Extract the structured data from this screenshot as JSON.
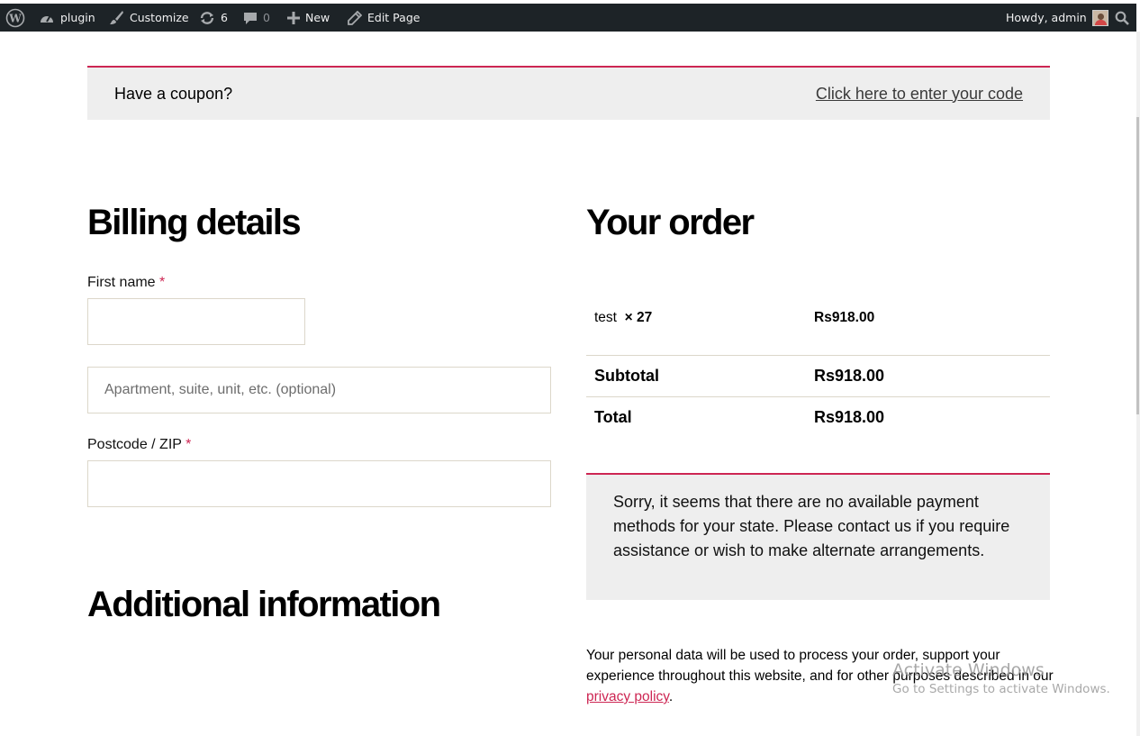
{
  "admin_bar": {
    "site_name": "plugin",
    "customize": "Customize",
    "updates_count": "6",
    "comments_count": "0",
    "new_label": "New",
    "edit_page": "Edit Page",
    "greeting": "Howdy, admin",
    "icons": [
      "wordpress-logo-icon",
      "dashboard-icon",
      "brush-icon",
      "updates-icon",
      "comment-icon",
      "plus-icon",
      "pencil-icon",
      "avatar",
      "search-icon"
    ]
  },
  "coupon": {
    "prompt": "Have a coupon?",
    "link": "Click here to enter your code"
  },
  "billing": {
    "heading": "Billing details",
    "first_name_label": "First name",
    "required_mark": "*",
    "first_name_value": "",
    "address2_placeholder": "Apartment, suite, unit, etc. (optional)",
    "postcode_label": "Postcode / ZIP",
    "postcode_value": ""
  },
  "additional": {
    "heading": "Additional information"
  },
  "order": {
    "heading": "Your order",
    "items": [
      {
        "name": "test",
        "qty": "× 27",
        "total": "Rs918.00"
      }
    ],
    "subtotal_label": "Subtotal",
    "subtotal_value": "Rs918.00",
    "total_label": "Total",
    "total_value": "Rs918.00"
  },
  "payment_notice": "Sorry, it seems that there are no available payment methods for your state. Please contact us if you require assistance or wish to make alternate arrangements.",
  "privacy": {
    "text_before": "Your personal data will be used to process your order, support your experience throughout this website, and for other purposes described in our ",
    "link": "privacy policy",
    "text_after": "."
  },
  "watermark": {
    "line1": "Activate Windows",
    "line2": "Go to Settings to activate Windows."
  },
  "colors": {
    "accent": "#cd2653",
    "admin_bar_bg": "#1d2327",
    "notice_bg": "#eeeeee"
  }
}
